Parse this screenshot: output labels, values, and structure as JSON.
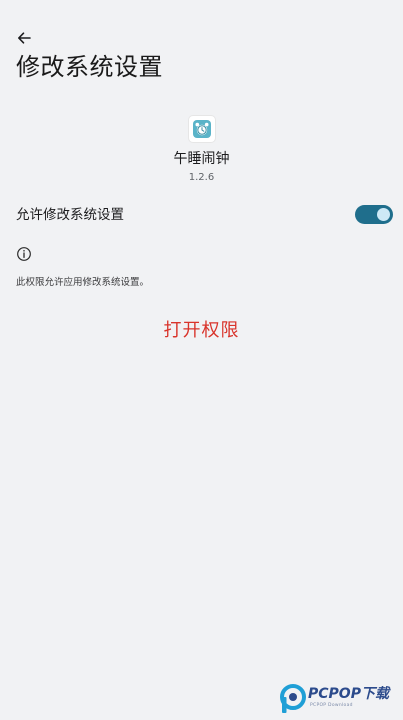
{
  "header": {
    "title": "修改系统设置",
    "back_icon": "arrow-back-icon"
  },
  "app": {
    "icon": "alarm-clock-icon",
    "name": "午睡闹钟",
    "version": "1.2.6"
  },
  "permission": {
    "toggle_label": "允许修改系统设置",
    "toggle_on": true,
    "info_icon": "info-icon",
    "info_text": "此权限允许应用修改系统设置。",
    "open_button_label": "打开权限"
  },
  "watermark": {
    "brand": "PCPOP下载",
    "subtitle": "PCPOP Download"
  },
  "colors": {
    "background": "#f1f2f4",
    "switch_track": "#1f6e8c",
    "switch_thumb": "#cde9f6",
    "action_red": "#d9342b",
    "app_icon_teal": "#5ab3c8"
  }
}
